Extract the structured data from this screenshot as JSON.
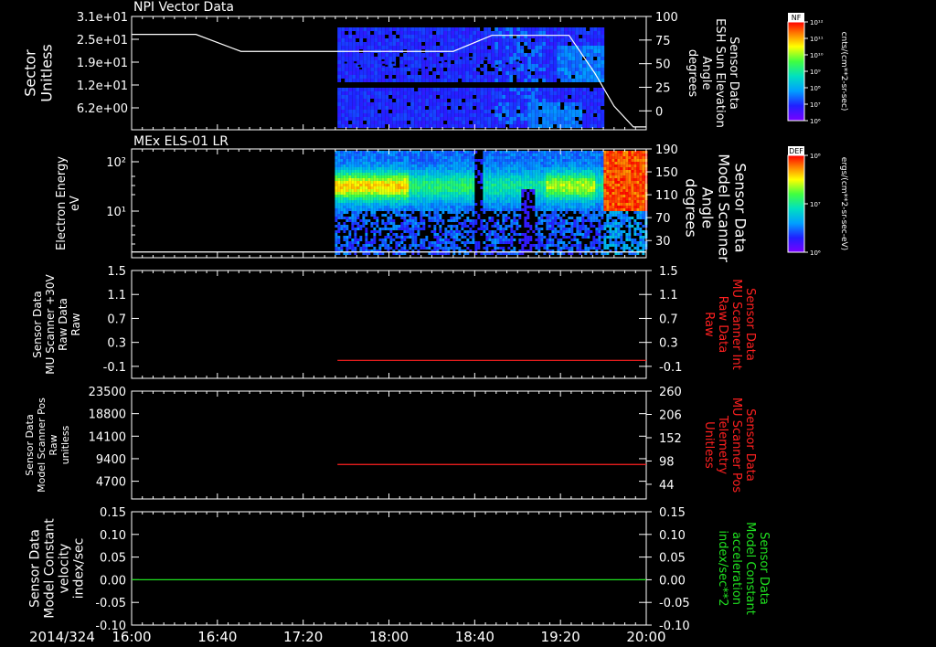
{
  "time_axis": {
    "date_label": "2014/324",
    "ticks": [
      "16:00",
      "16:40",
      "17:20",
      "18:00",
      "18:40",
      "19:20",
      "20:00"
    ],
    "range_hours": [
      16.0,
      20.0
    ]
  },
  "chart_data": [
    {
      "type": "heatmap",
      "title": "NPI Vector Data",
      "ylabel": [
        "Sector",
        "Unitless"
      ],
      "ytick_labels": [
        "3.1e+01",
        "2.5e+01",
        "1.9e+01",
        "1.2e+01",
        "6.2e+00"
      ],
      "right_axis": {
        "label": [
          "Sensor Data",
          "ESH Sun Elevation",
          "Angle",
          "degrees"
        ],
        "range": [
          -20,
          100
        ],
        "ticks": [
          "100",
          "75",
          "50",
          "25",
          "0"
        ],
        "tick_values": [
          100,
          75,
          50,
          25,
          0
        ]
      },
      "data_time_range": [
        17.6,
        19.65
      ],
      "colorbar": {
        "tag": "NF",
        "label": "cnts/(cm**2-sr-sec)",
        "ticks": [
          "10¹²",
          "10¹¹",
          "10¹⁰",
          "10⁹",
          "10⁸",
          "10⁷",
          "10⁶"
        ]
      },
      "line_series": {
        "color": "#ffffff",
        "x": [
          16.0,
          16.5,
          16.85,
          17.2,
          17.6,
          18.0,
          18.5,
          18.8,
          19.1,
          19.4,
          19.6,
          19.75,
          19.9,
          20.0
        ],
        "y": [
          81,
          81,
          63,
          63,
          63,
          63,
          63,
          80,
          80,
          80,
          40,
          5,
          -17,
          -17
        ]
      }
    },
    {
      "type": "heatmap",
      "title": "MEx ELS-01 LR",
      "ylabel": [
        "Electron Energy",
        "eV"
      ],
      "ytick_labels": [
        "10²",
        "10¹"
      ],
      "right_axis": {
        "label": [
          "Sensor Data",
          "Model Scanner",
          "Angle",
          "degrees"
        ],
        "range": [
          0,
          190
        ],
        "ticks": [
          "190",
          "150",
          "110",
          "70",
          "30"
        ],
        "tick_values": [
          190,
          150,
          110,
          70,
          30
        ]
      },
      "data_time_range": [
        17.58,
        20.0
      ],
      "colorbar": {
        "tag": "DEF",
        "label": "ergs/(cm**2-sr-sec-eV)",
        "ticks": [
          "10⁸",
          "10⁷",
          "10⁶"
        ]
      },
      "line_series": {
        "color": "#ffffff",
        "x": [
          16.0,
          20.0
        ],
        "y": [
          10,
          10
        ]
      }
    },
    {
      "type": "line",
      "ylabel": [
        "Sensor Data",
        "MU Scanner +30V",
        "Raw Data",
        "Raw"
      ],
      "right_label": [
        "Sensor Data",
        "MU Scanner Int",
        "Raw Data",
        "Raw"
      ],
      "label_color": "#ff2020",
      "ylim": [
        -0.3,
        1.5
      ],
      "ticks": [
        "1.5",
        "1.1",
        "0.7",
        "0.3",
        "-0.1"
      ],
      "tick_values": [
        1.5,
        1.1,
        0.7,
        0.3,
        -0.1
      ],
      "series": [
        {
          "color": "#ff2020",
          "x": [
            17.6,
            20.0
          ],
          "y": [
            0.0,
            0.0
          ]
        }
      ]
    },
    {
      "type": "line",
      "ylabel": [
        "Sensor Data",
        "Model Scanner Pos",
        "Raw",
        "unitless"
      ],
      "ylim": [
        1000,
        23500
      ],
      "ticks": [
        "23500",
        "18800",
        "14100",
        "9400",
        "4700"
      ],
      "tick_values": [
        23500,
        18800,
        14100,
        9400,
        4700
      ],
      "right_label": [
        "Sensor Data",
        "MU Scanner Pos",
        "Telemetry",
        "Unitless"
      ],
      "label_color": "#ff2020",
      "right_axis": {
        "range": [
          10,
          260
        ],
        "ticks": [
          "260",
          "206",
          "152",
          "98",
          "44"
        ],
        "tick_values": [
          260,
          206,
          152,
          98,
          44
        ]
      },
      "series": [
        {
          "color": "#ff2020",
          "x": [
            17.6,
            20.0
          ],
          "y": [
            8200,
            8200
          ]
        }
      ]
    },
    {
      "type": "line",
      "ylabel": [
        "Sensor Data",
        "Model Constant",
        "velocity",
        "index/sec"
      ],
      "right_label": [
        "Sensor Data",
        "Model Constant",
        "acceleration",
        "index/sec**2"
      ],
      "label_color": "#20e020",
      "ylim": [
        -0.1,
        0.15
      ],
      "ticks": [
        "0.15",
        "0.10",
        "0.05",
        "0.00",
        "-0.05",
        "-0.10"
      ],
      "tick_values": [
        0.15,
        0.1,
        0.05,
        0.0,
        -0.05,
        -0.1
      ],
      "series": [
        {
          "color": "#20e020",
          "x": [
            16.0,
            20.0
          ],
          "y": [
            0.0,
            0.0
          ]
        }
      ]
    }
  ]
}
